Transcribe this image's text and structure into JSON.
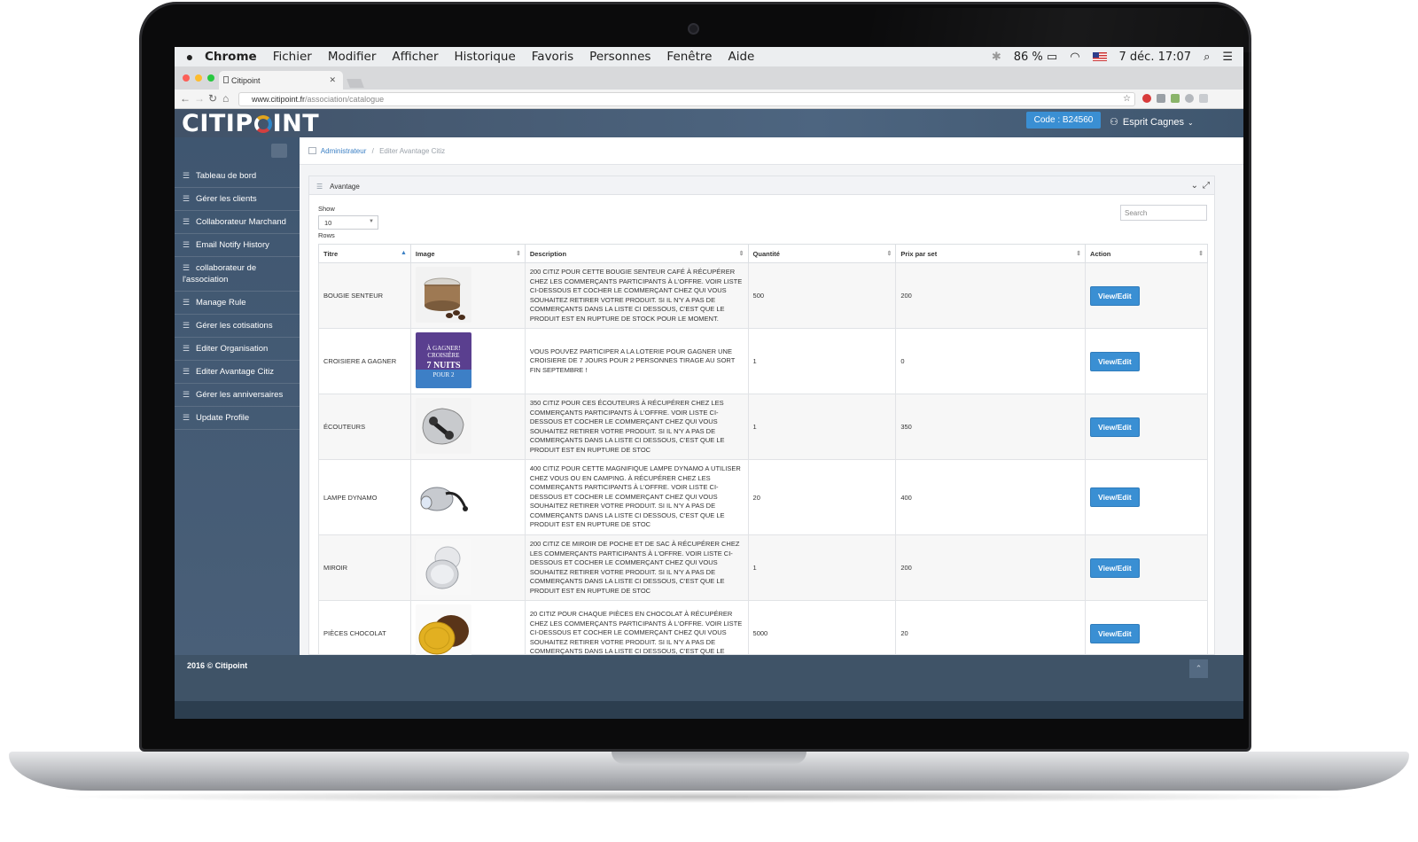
{
  "menubar": {
    "items": [
      "Chrome",
      "Fichier",
      "Modifier",
      "Afficher",
      "Historique",
      "Favoris",
      "Personnes",
      "Fenêtre",
      "Aide"
    ],
    "battery": "86 %",
    "datetime": "7 déc. 17:07"
  },
  "browser": {
    "tab_title": "Citipoint",
    "url_host": "www.citipoint.fr",
    "url_path": "/association/catalogue"
  },
  "header": {
    "logo_left": "CITIP",
    "logo_right": "INT",
    "code_badge": "Code : B24560",
    "user_name": "Esprit Cagnes"
  },
  "sidebar": {
    "items": [
      {
        "label": "Tableau de bord"
      },
      {
        "label": "Gérer les clients"
      },
      {
        "label": "Collaborateur Marchand"
      },
      {
        "label": "Email Notify History"
      },
      {
        "label": "collaborateur de l'association"
      },
      {
        "label": "Manage Rule"
      },
      {
        "label": "Gérer les cotisations"
      },
      {
        "label": "Editer Organisation"
      },
      {
        "label": "Editer Avantage Citiz"
      },
      {
        "label": "Gérer les anniversaires"
      },
      {
        "label": "Update Profile"
      }
    ]
  },
  "breadcrumb": {
    "root": "Administrateur",
    "separator": "/",
    "current": "Editer Avantage Citiz"
  },
  "panel": {
    "title": "Avantage",
    "show_label": "Show",
    "show_value": "10",
    "rows_label": "Rows",
    "search_placeholder": "Search"
  },
  "table": {
    "headers": [
      "Titre",
      "Image",
      "Description",
      "Quantité",
      "Prix par set",
      "Action"
    ],
    "action_label": "View/Edit",
    "rows": [
      {
        "titre": "BOUGIE SENTEUR",
        "image_icon": "candle-image",
        "description": "200 CITIZ POUR CETTE BOUGIE SENTEUR CAFÉ À RÉCUPÉRER CHEZ LES COMMERÇANTS PARTICIPANTS À L'OFFRE. VOIR LISTE CI-DESSOUS ET COCHER LE COMMERÇANT CHEZ QUI VOUS SOUHAITEZ RETIRER VOTRE PRODUIT. SI IL N'Y A PAS DE COMMERÇANTS DANS LA LISTE CI DESSOUS, C'EST QUE LE PRODUIT EST EN RUPTURE DE STOCK POUR LE MOMENT.",
        "quantite": "500",
        "prix": "200"
      },
      {
        "titre": "CROISIERE A GAGNER",
        "image_icon": "cruise-image",
        "image_text": [
          "À GAGNER!",
          "CROISIÈRE",
          "7 NUITS",
          "POUR 2"
        ],
        "description": "VOUS POUVEZ PARTICIPER A LA LOTERIE POUR GAGNER UNE CROISIERE DE 7 JOURS POUR 2 PERSONNES TIRAGE AU SORT FIN SEPTEMBRE !",
        "quantite": "1",
        "prix": "0"
      },
      {
        "titre": "ÉCOUTEURS",
        "image_icon": "earphones-image",
        "description": "350 CITIZ POUR CES ÉCOUTEURS À RÉCUPÉRER CHEZ LES COMMERÇANTS PARTICIPANTS À L'OFFRE. VOIR LISTE CI-DESSOUS ET COCHER LE COMMERÇANT CHEZ QUI VOUS SOUHAITEZ RETIRER VOTRE PRODUIT. SI IL N'Y A PAS DE COMMERÇANTS DANS LA LISTE CI DESSOUS, C'EST QUE LE PRODUIT EST EN RUPTURE DE STOC",
        "quantite": "1",
        "prix": "350"
      },
      {
        "titre": "LAMPE DYNAMO",
        "image_icon": "dynamo-lamp-image",
        "description": "400 CITIZ POUR CETTE MAGNIFIQUE LAMPE DYNAMO A UTILISER CHEZ VOUS OU EN CAMPING. À RÉCUPÉRER CHEZ LES COMMERÇANTS PARTICIPANTS À L'OFFRE. VOIR LISTE CI-DESSOUS ET COCHER LE COMMERÇANT CHEZ QUI VOUS SOUHAITEZ RETIRER VOTRE PRODUIT. SI IL N'Y A PAS DE COMMERÇANTS DANS LA LISTE CI DESSOUS, C'EST QUE LE PRODUIT EST EN RUPTURE DE STOC",
        "quantite": "20",
        "prix": "400"
      },
      {
        "titre": "MIROIR",
        "image_icon": "mirror-image",
        "description": "200 CITIZ CE MIROIR DE POCHE ET DE SAC À RÉCUPÉRER CHEZ LES COMMERÇANTS PARTICIPANTS À L'OFFRE. VOIR LISTE CI-DESSOUS ET COCHER LE COMMERÇANT CHEZ QUI VOUS SOUHAITEZ RETIRER VOTRE PRODUIT. SI IL N'Y A PAS DE COMMERÇANTS DANS LA LISTE CI DESSOUS, C'EST QUE LE PRODUIT EST EN RUPTURE DE STOC",
        "quantite": "1",
        "prix": "200"
      },
      {
        "titre": "PIÈCES CHOCOLAT",
        "image_icon": "chocolate-coins-image",
        "description": "20 CITIZ POUR CHAQUE PIÈCES EN CHOCOLAT À RÉCUPÉRER CHEZ LES COMMERÇANTS PARTICIPANTS À L'OFFRE. VOIR LISTE CI-DESSOUS ET COCHER LE COMMERÇANT CHEZ QUI VOUS SOUHAITEZ RETIRER VOTRE PRODUIT. SI IL N'Y A PAS DE COMMERÇANTS DANS LA LISTE CI DESSOUS, C'EST QUE LE",
        "quantite": "5000",
        "prix": "20"
      }
    ]
  },
  "footer": {
    "copyright": "2016 © Citipoint"
  },
  "colors": {
    "accent": "#3a8fd3",
    "sidebar": "#435a73",
    "header": "#4a607a"
  }
}
